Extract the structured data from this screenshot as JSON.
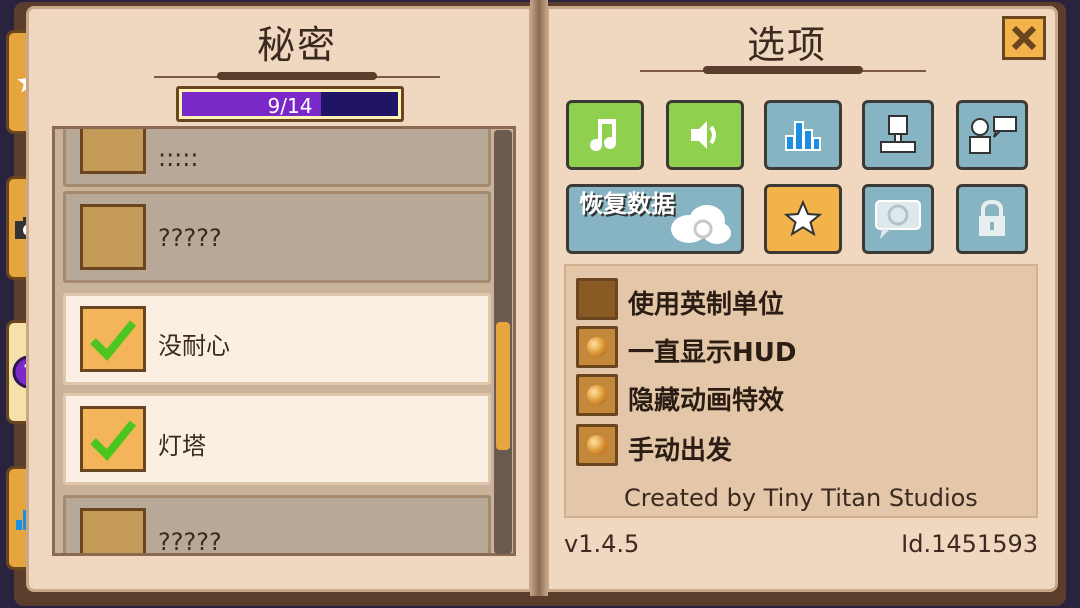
{
  "left_page": {
    "title": "秘密",
    "progress": {
      "text": "9/14",
      "value": 9,
      "max": 14
    },
    "secrets": [
      {
        "label": ":::::",
        "status": "locked"
      },
      {
        "label": "?????",
        "status": "locked"
      },
      {
        "label": "没耐心",
        "status": "unlocked"
      },
      {
        "label": "灯塔",
        "status": "unlocked"
      },
      {
        "label": "?????",
        "status": "locked"
      }
    ]
  },
  "side_tabs": [
    {
      "icon": "star-icon"
    },
    {
      "icon": "camera-icon"
    },
    {
      "icon": "question-icon",
      "active": true
    },
    {
      "icon": "bar-chart-icon"
    }
  ],
  "right_page": {
    "title": "选项",
    "buttons": {
      "music": "music-note-icon",
      "sound": "speaker-icon",
      "stats": "bar-chart-icon",
      "profile": "stamp-icon",
      "community": "speech-person-icon",
      "restore_label": "恢复数据",
      "restore_icon": "cloud-sync-icon",
      "favorite": "star-icon",
      "language": "globe-bubble-icon",
      "lock": "padlock-icon"
    },
    "options": [
      {
        "label": "使用英制单位",
        "checked": false
      },
      {
        "label": "一直显示HUD",
        "checked": true
      },
      {
        "label": "隐藏动画特效",
        "checked": true
      },
      {
        "label": "手动出发",
        "checked": true
      }
    ],
    "credit": "Created by Tiny Titan Studios",
    "version": "v1.4.5",
    "id": "Id.1451593"
  },
  "colors": {
    "accent_green": "#8fd14f",
    "accent_blue": "#86b4c2",
    "accent_orange": "#f2b44a",
    "progress_fill": "#7a28c8",
    "page": "#f0d8c0"
  }
}
